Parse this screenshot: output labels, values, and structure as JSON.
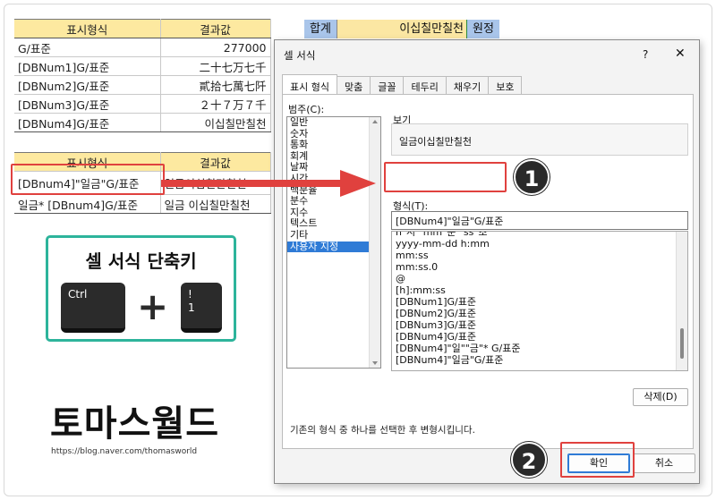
{
  "table1": {
    "headers": [
      "표시형식",
      "결과값"
    ],
    "rows": [
      [
        "G/표준",
        "277000"
      ],
      [
        "[DBNum1]G/표준",
        "二十七万七千"
      ],
      [
        "[DBNum2]G/표준",
        "貳拾七萬七阡"
      ],
      [
        "[DBNum3]G/표준",
        "２十７万７千"
      ],
      [
        "[DBNum4]G/표준",
        "이십칠만칠천"
      ]
    ]
  },
  "table2": {
    "headers": [
      "표시형식",
      "결과값"
    ],
    "rows": [
      [
        "[DBnum4]\"일금\"G/표준",
        "일금이십칠만칠천"
      ],
      [
        "일금* [DBnum4]G/표준",
        "일금    이십칠만칠천"
      ]
    ]
  },
  "strip": {
    "left": "합계",
    "mid": "이십칠만칠천",
    "right": "원정"
  },
  "shortcut": {
    "title": "셀 서식 단축키",
    "key1": "Ctrl",
    "plus": "+",
    "key2_top": "!",
    "key2_bottom": "1"
  },
  "logo": {
    "name": "토마스월드",
    "url": "https://blog.naver.com/thomasworld"
  },
  "callouts": {
    "one": "1",
    "two": "2"
  },
  "dialog": {
    "title": "셀 서식",
    "help": "?",
    "close": "✕",
    "tabs": [
      "표시 형식",
      "맞춤",
      "글꼴",
      "테두리",
      "채우기",
      "보호"
    ],
    "category_label": "범주(C):",
    "categories": [
      "일반",
      "숫자",
      "통화",
      "회계",
      "날짜",
      "시간",
      "백분율",
      "분수",
      "지수",
      "텍스트",
      "기타",
      "사용자 지정"
    ],
    "selected_category": "사용자 지정",
    "sample_label": "보기",
    "sample_value": "일금이십칠만칠천",
    "format_label": "형식(T):",
    "format_value": "[DBNum4]\"일금\"G/표준",
    "format_list": [
      "h\"시\" mm\"분\" ss\"초\"",
      "yyyy-mm-dd h:mm",
      "mm:ss",
      "mm:ss.0",
      "@",
      "[h]:mm:ss",
      "[DBNum1]G/표준",
      "[DBNum2]G/표준",
      "[DBNum3]G/표준",
      "[DBNum4]G/표준",
      "[DBNum4]\"일\"\"금\"* G/표준",
      "[DBNum4]\"일금\"G/표준"
    ],
    "delete_button": "삭제(D)",
    "hint": "기존의 형식 중 하나를 선택한 후 변형시킵니다.",
    "ok_button": "확인",
    "cancel_button": "취소"
  },
  "colors": {
    "highlight": "#e0413e",
    "card_border": "#2db49b",
    "header_fill": "#fde9a0",
    "selection": "#2f7bd6"
  }
}
